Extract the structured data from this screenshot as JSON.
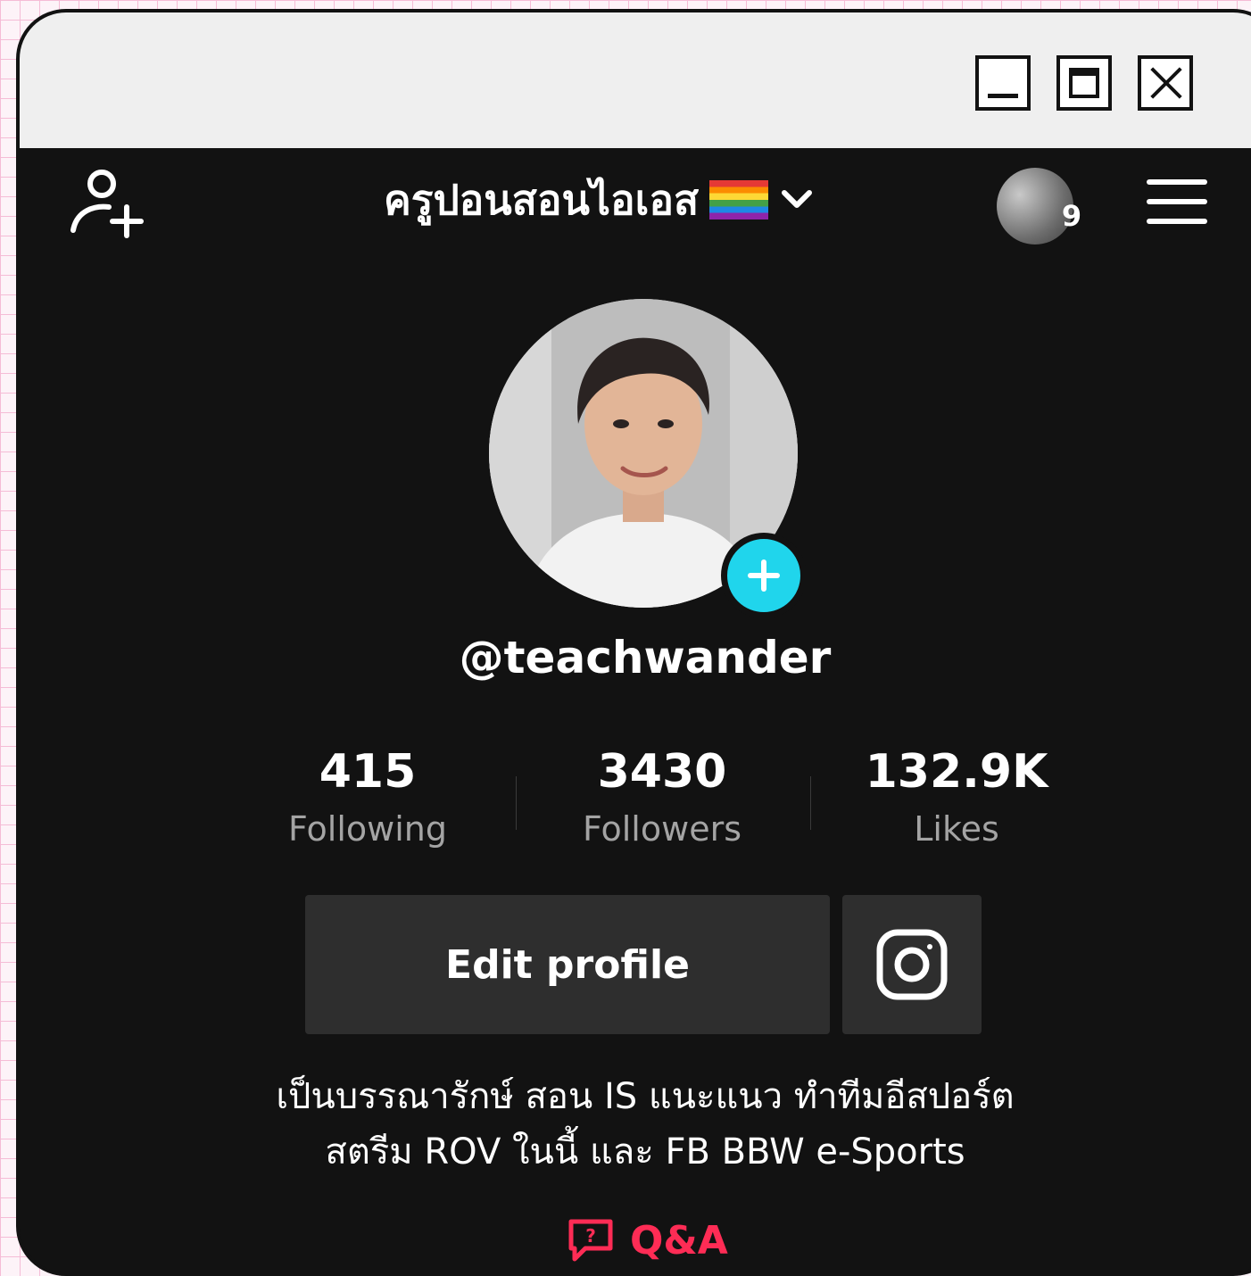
{
  "header": {
    "title": "ครูปอนสอนไอเอส",
    "flag_icon": "rainbow-flag-icon",
    "story_badge_count": "9"
  },
  "profile": {
    "username": "@teachwander",
    "stats": [
      {
        "value": "415",
        "label": "Following"
      },
      {
        "value": "3430",
        "label": "Followers"
      },
      {
        "value": "132.9K",
        "label": "Likes"
      }
    ],
    "edit_button_label": "Edit profile",
    "bio_lines": [
      "เป็นบรรณารักษ์ สอน IS แนะแนว ทำทีมอีสปอร์ต",
      "สตรีม ROV ในนี้ และ FB BBW e-Sports"
    ],
    "qa_label": "Q&A"
  },
  "colors": {
    "background": "#121212",
    "accent_cyan": "#20d5ec",
    "accent_red": "#fe2c55",
    "button_bg": "#2e2e2e",
    "muted_text": "#a4a4a4"
  }
}
